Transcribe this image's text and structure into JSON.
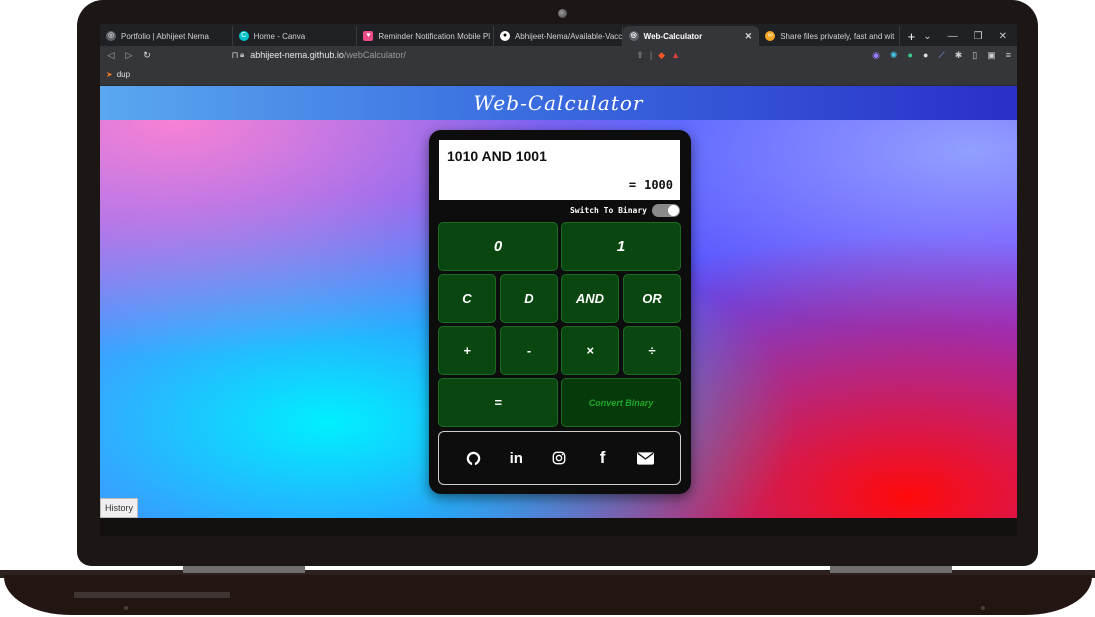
{
  "tabs": [
    {
      "title": "Portfolio | Abhijeet Nema",
      "icon": "globe-icon",
      "color": "#5f6368"
    },
    {
      "title": "Home - Canva",
      "icon": "canva-icon",
      "color": "#00c4cc"
    },
    {
      "title": "Reminder Notification Mobile Pl",
      "icon": "dribbble-icon",
      "color": "#ea4c89"
    },
    {
      "title": "Abhijeet-Nema/Available-Vaccin",
      "icon": "github-icon",
      "color": "#ffffff"
    },
    {
      "title": "Web-Calculator",
      "icon": "globe-icon",
      "color": "#5f6368",
      "active": true
    },
    {
      "title": "Share files privately, fast and wit",
      "icon": "share-icon",
      "color": "#f5a623"
    }
  ],
  "address": {
    "host": "abhijeet-nema.github.io",
    "path": "/webCalculator/"
  },
  "bookmarks": [
    {
      "label": "dup",
      "icon": "folder-icon"
    }
  ],
  "page": {
    "title": "Web-Calculator",
    "history_label": "History"
  },
  "calculator": {
    "expression": "1010 AND 1001",
    "result": "1000",
    "equals": "=",
    "switch_label": "Switch To Binary",
    "switch_on": true,
    "keys": {
      "zero": "0",
      "one": "1",
      "clear": "C",
      "delete": "D",
      "and": "AND",
      "or": "OR",
      "plus": "+",
      "minus": "-",
      "times": "×",
      "divide": "÷",
      "equals": "=",
      "convert": "Convert Binary"
    }
  },
  "social": [
    "github-icon",
    "linkedin-icon",
    "instagram-icon",
    "facebook-icon",
    "mail-icon"
  ],
  "colors": {
    "key_bg": "#0a4710",
    "convert_text": "#1fa82a",
    "header_start": "#5aa8f0",
    "header_end": "#2a2fc8"
  }
}
